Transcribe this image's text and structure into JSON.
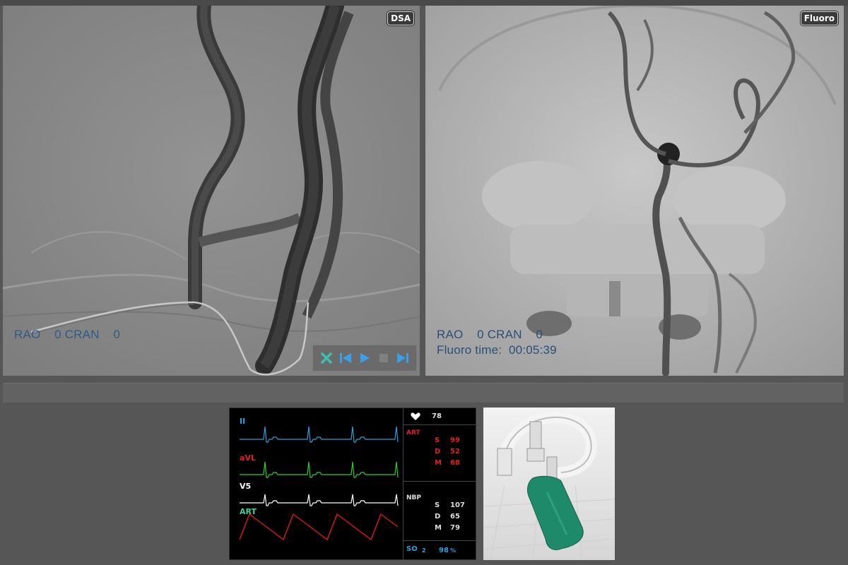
{
  "dsa": {
    "badge": "DSA",
    "angles": "RAO    0 CRAN    0"
  },
  "fluoro": {
    "badge": "Fluoro",
    "angles": "RAO    0 CRAN    0",
    "time_label": "Fluoro time:",
    "time_value": "00:05:39"
  },
  "playback": {
    "icons": [
      "close-icon",
      "skip-back-icon",
      "play-icon",
      "stop-icon",
      "skip-forward-icon"
    ]
  },
  "monitor": {
    "leads": [
      {
        "label": "II",
        "color": "#2aa0e0"
      },
      {
        "label": "aVL",
        "color": "#e02020"
      },
      {
        "label": "V5",
        "color": "#ffffff"
      },
      {
        "label": "ART",
        "color": "#40d0a0"
      }
    ],
    "trace_colors": [
      "#2a9fe0",
      "#2ed02e",
      "#ffffff",
      "#e01818"
    ],
    "heart_rate": "78",
    "art": {
      "label": "ART",
      "s_key": "S",
      "s_val": "99",
      "d_key": "D",
      "d_val": "52",
      "m_key": "M",
      "m_val": "68"
    },
    "nbp": {
      "label": "NBP",
      "s_key": "S",
      "s_val": "107",
      "d_key": "D",
      "d_val": "65",
      "m_key": "M",
      "m_val": "79"
    },
    "spo2": {
      "label": "SO",
      "sub": "2",
      "value": "98",
      "unit": "%"
    }
  }
}
